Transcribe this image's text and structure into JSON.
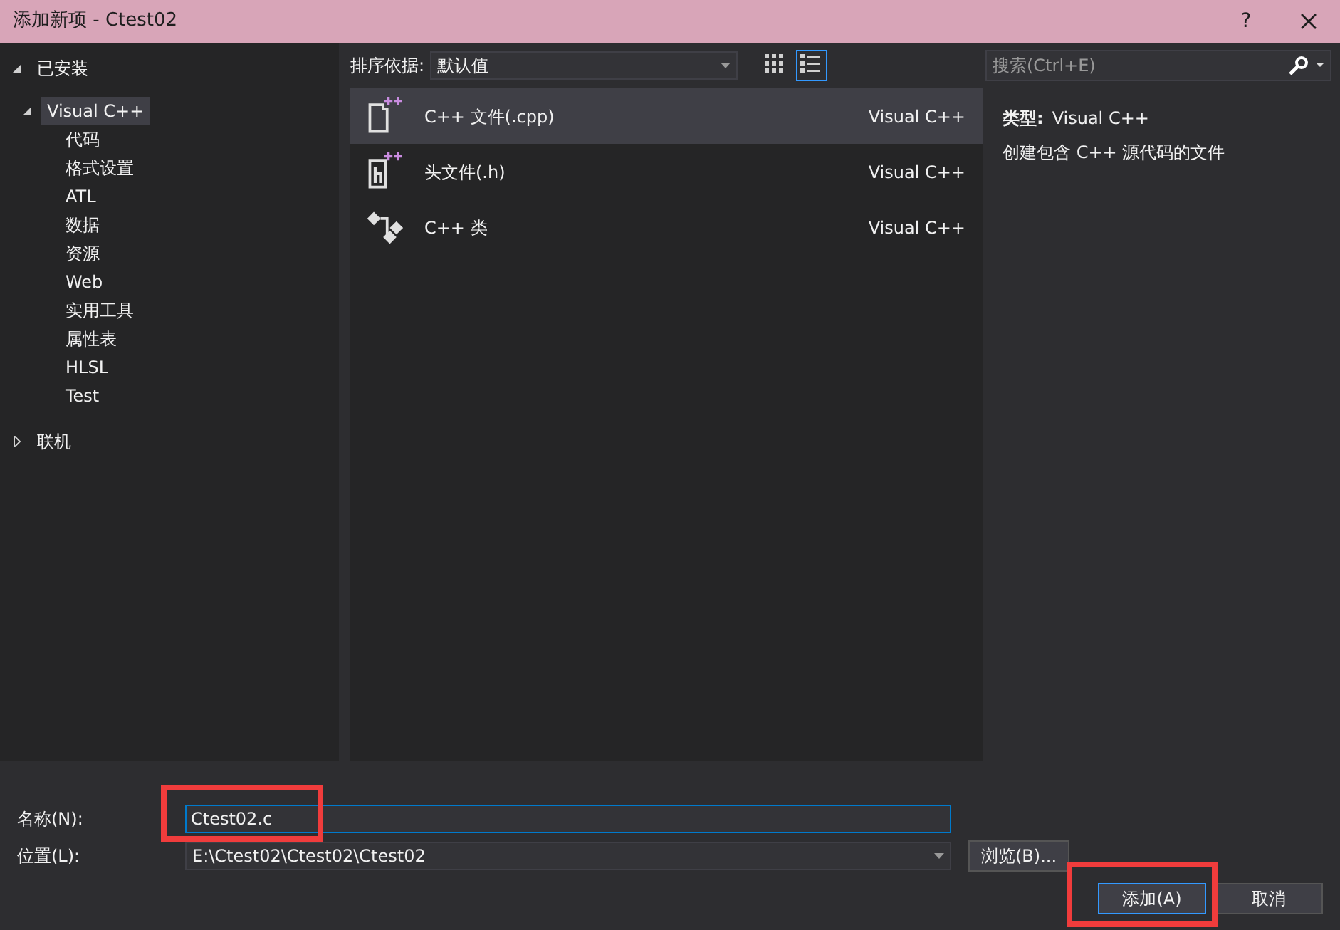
{
  "window": {
    "title": "添加新项 - Ctest02",
    "help": "?"
  },
  "tree": [
    {
      "label": "已安装",
      "expanded": true,
      "selected": false,
      "children": [
        {
          "label": "Visual C++",
          "expanded": true,
          "selected": true,
          "children": [
            {
              "label": "代码",
              "selected": false
            },
            {
              "label": "格式设置",
              "selected": false
            },
            {
              "label": "ATL",
              "selected": false
            },
            {
              "label": "数据",
              "selected": false
            },
            {
              "label": "资源",
              "selected": false
            },
            {
              "label": "Web",
              "selected": false
            },
            {
              "label": "实用工具",
              "selected": false
            },
            {
              "label": "属性表",
              "selected": false
            },
            {
              "label": "HLSL",
              "selected": false
            },
            {
              "label": "Test",
              "selected": false
            }
          ]
        }
      ]
    },
    {
      "label": "联机",
      "expanded": false,
      "selected": false
    }
  ],
  "sort": {
    "label": "排序依据:",
    "value": "默认值"
  },
  "view_modes": [
    {
      "kind": "grid",
      "selected": false
    },
    {
      "kind": "list",
      "selected": true
    }
  ],
  "search": {
    "placeholder": "搜索(Ctrl+E)"
  },
  "templates": [
    {
      "kind": "cpp",
      "name": "C++ 文件(.cpp)",
      "category": "Visual C++",
      "selected": true
    },
    {
      "kind": "header",
      "name": "头文件(.h)",
      "category": "Visual C++",
      "selected": false
    },
    {
      "kind": "class",
      "name": "C++ 类",
      "category": "Visual C++",
      "selected": false
    }
  ],
  "details": {
    "type_label": "类型:",
    "type_value": "Visual C++",
    "description": "创建包含 C++ 源代码的文件"
  },
  "form": {
    "name_label": "名称(N):",
    "name_value": "Ctest02.c",
    "name_highlighted": true,
    "location_label": "位置(L):",
    "location_value": "E:\\Ctest02\\Ctest02\\Ctest02",
    "browse": "浏览(B)..."
  },
  "buttons": [
    {
      "label": "添加(A)",
      "default": true,
      "highlighted": true
    },
    {
      "label": "取消",
      "default": false,
      "highlighted": false
    }
  ]
}
